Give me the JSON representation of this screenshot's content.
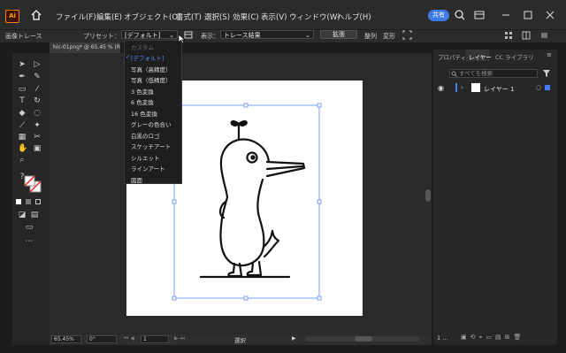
{
  "app": {
    "logo": "Ai",
    "share_label": "共有"
  },
  "menubar": {
    "items": [
      "ファイル(F)",
      "編集(E)",
      "オブジェクト(O)",
      "書式(T)",
      "選択(S)",
      "効果(C)",
      "表示(V)",
      "ウィンドウ(W)",
      "ヘルプ(H)"
    ]
  },
  "controlbar": {
    "panel_title": "画像トレース",
    "preset_label": "プリセット：",
    "preset_value": "[デフォルト]",
    "view_label": "表示：",
    "view_value": "トレース結果",
    "expand_label": "拡張",
    "align_label": "整列",
    "transform_label": "変形"
  },
  "document": {
    "tab_title": "hic-01png* @ 65.45 % (RG"
  },
  "preset_menu": {
    "items": [
      {
        "label": "カスタム",
        "disabled": true,
        "checked": false
      },
      {
        "label": "[デフォルト]",
        "disabled": false,
        "checked": true
      },
      {
        "label": "写真（高精度）",
        "disabled": false,
        "checked": false
      },
      {
        "label": "写真（低精度）",
        "disabled": false,
        "checked": false
      },
      {
        "label": "3 色変換",
        "disabled": false,
        "checked": false
      },
      {
        "label": "6 色変換",
        "disabled": false,
        "checked": false
      },
      {
        "label": "16 色変換",
        "disabled": false,
        "checked": false
      },
      {
        "label": "グレーの色合い",
        "disabled": false,
        "checked": false
      },
      {
        "label": "白黒のロゴ",
        "disabled": false,
        "checked": false
      },
      {
        "label": "スケッチアート",
        "disabled": false,
        "checked": false
      },
      {
        "label": "シルエット",
        "disabled": false,
        "checked": false
      },
      {
        "label": "ラインアート",
        "disabled": false,
        "checked": false
      },
      {
        "label": "図面",
        "disabled": false,
        "checked": false
      }
    ]
  },
  "panel": {
    "tabs": [
      "プロパティ",
      "レイヤー",
      "CC ライブラリ"
    ],
    "active_tab": "レイヤー",
    "search_placeholder": "すべてを検索",
    "layer_name": "レイヤー 1",
    "layer_count": "1 ..."
  },
  "statusbar": {
    "zoom": "65.45%",
    "rotation": "0°",
    "artboard": "1",
    "mode": "選択"
  },
  "colors": {
    "accent": "#3d7be6",
    "selection": "#5a8dee",
    "layer_color": "#4a7bff"
  }
}
